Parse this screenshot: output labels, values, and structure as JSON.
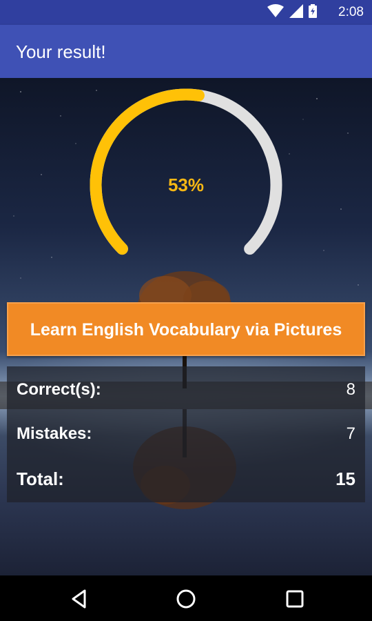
{
  "status_bar": {
    "time": "2:08",
    "icons": [
      "wifi-icon",
      "signal-icon",
      "battery-icon"
    ]
  },
  "app_bar": {
    "title": "Your result!"
  },
  "result": {
    "percent_text": "53%",
    "progress_fraction": 0.53,
    "progress_color": "#ffc107",
    "track_color": "#e0e0e0"
  },
  "cta": {
    "label": "Learn English Vocabulary via Pictures",
    "color": "#f18a25"
  },
  "stats": {
    "correct": {
      "label": "Correct(s):",
      "value": "8"
    },
    "mistakes": {
      "label": "Mistakes:",
      "value": "7"
    },
    "total": {
      "label": "Total:",
      "value": "15"
    }
  },
  "nav": {
    "icons": [
      "back-icon",
      "home-icon",
      "recents-icon"
    ]
  },
  "colors": {
    "primary": "#3f51b5",
    "primary_dark": "#303f9f"
  }
}
